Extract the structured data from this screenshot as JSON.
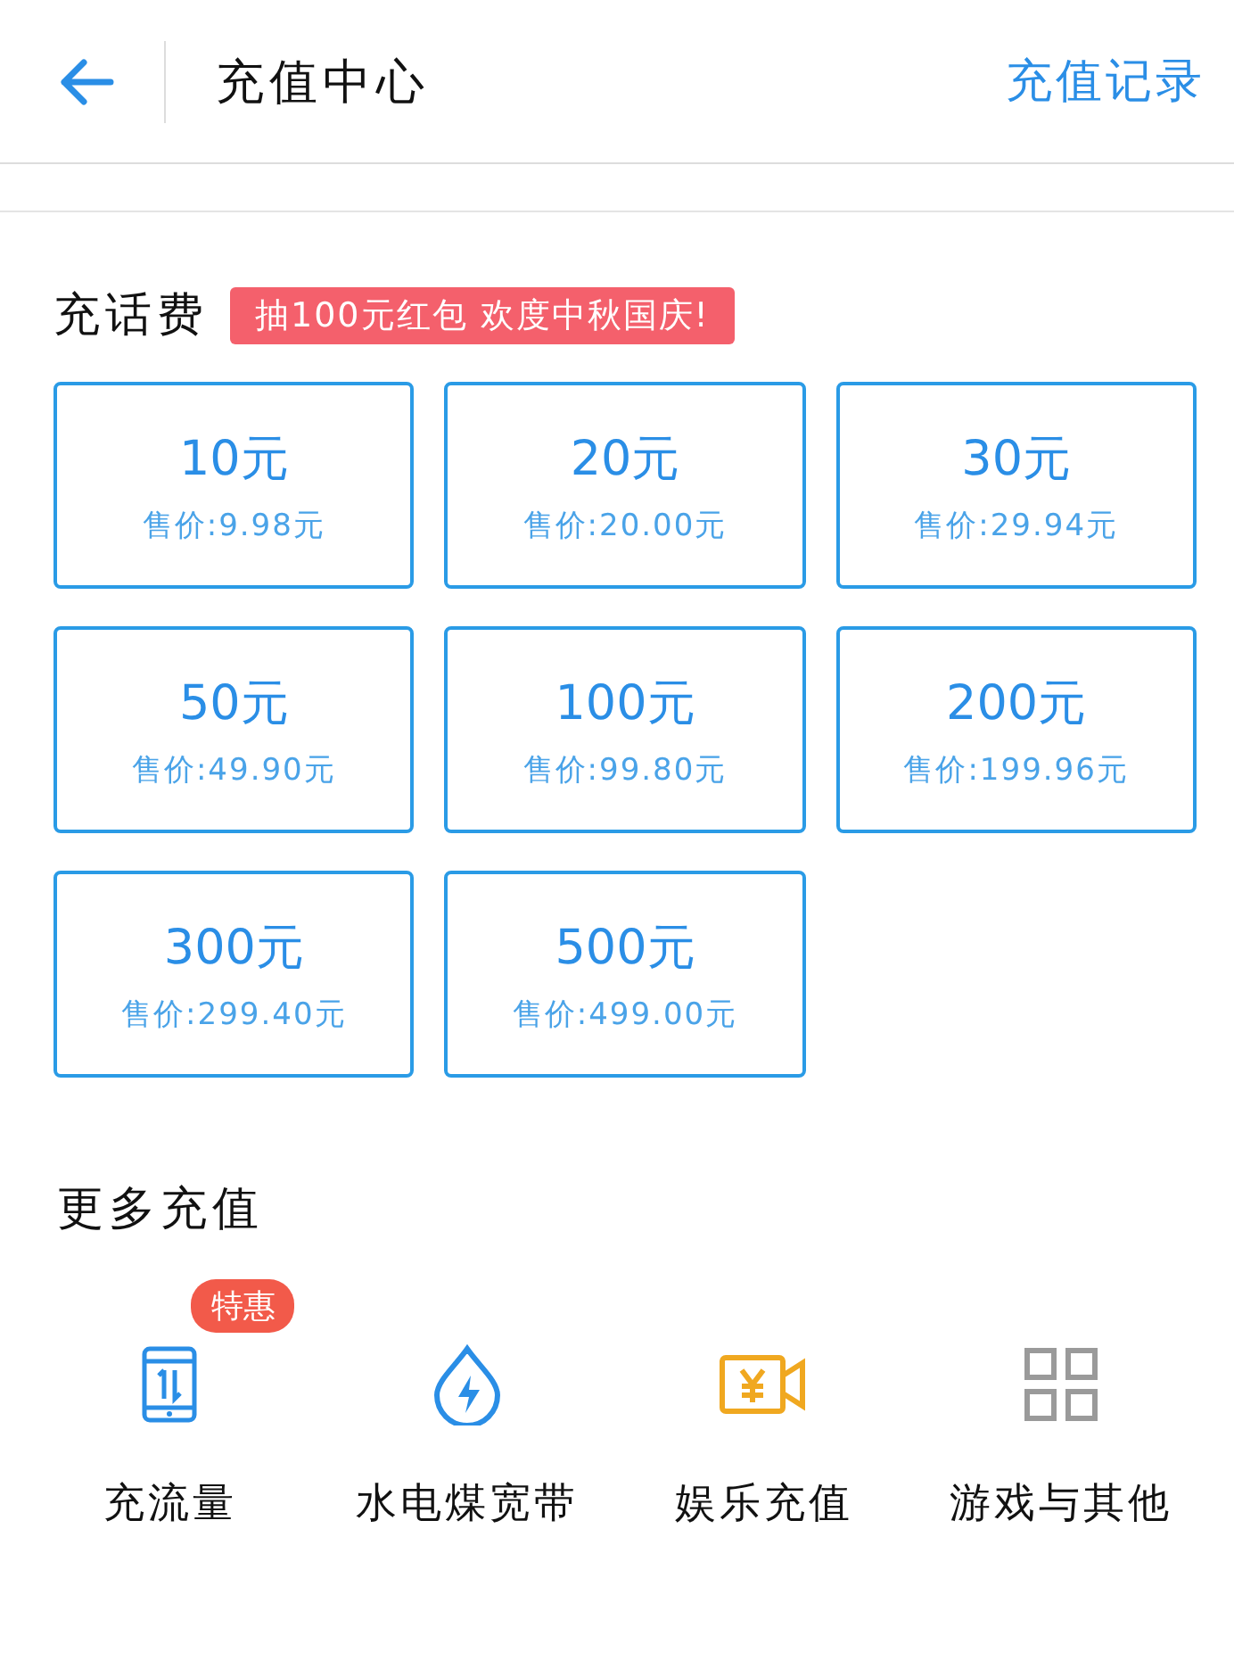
{
  "header": {
    "title": "充值中心",
    "action": "充值记录"
  },
  "phone_topup": {
    "title": "充话费",
    "promo": "抽100元红包 欢度中秋国庆!",
    "options": [
      {
        "amount": "10元",
        "price": "售价:9.98元"
      },
      {
        "amount": "20元",
        "price": "售价:20.00元"
      },
      {
        "amount": "30元",
        "price": "售价:29.94元"
      },
      {
        "amount": "50元",
        "price": "售价:49.90元"
      },
      {
        "amount": "100元",
        "price": "售价:99.80元"
      },
      {
        "amount": "200元",
        "price": "售价:199.96元"
      },
      {
        "amount": "300元",
        "price": "售价:299.40元"
      },
      {
        "amount": "500元",
        "price": "售价:499.00元"
      }
    ]
  },
  "more": {
    "title": "更多充值",
    "items": [
      {
        "label": "充流量",
        "badge": "特惠"
      },
      {
        "label": "水电煤宽带"
      },
      {
        "label": "娱乐充值"
      },
      {
        "label": "游戏与其他"
      }
    ]
  }
}
